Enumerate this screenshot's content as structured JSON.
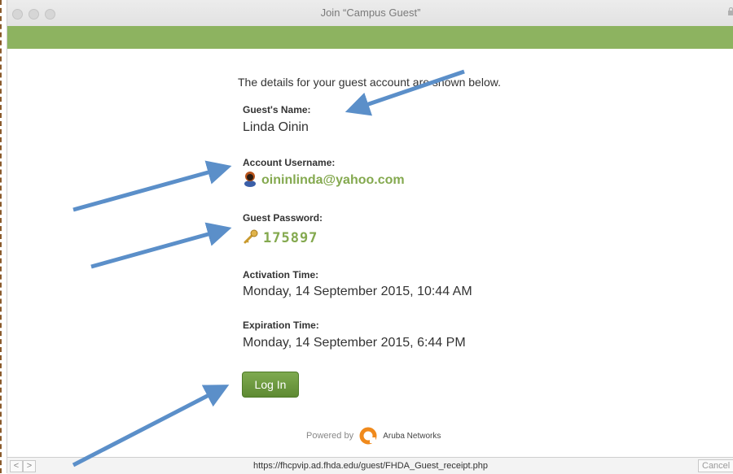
{
  "window": {
    "title": "Join “Campus Guest”"
  },
  "receipt": {
    "intro": "The details for your guest account are shown below.",
    "guest_name_label": "Guest's Name:",
    "guest_name": "Linda Oinin",
    "username_label": "Account Username:",
    "username": "oininlinda@yahoo.com",
    "password_label": "Guest Password:",
    "password": "175897",
    "activation_label": "Activation Time:",
    "activation_time": "Monday, 14 September 2015, 10:44 AM",
    "expiration_label": "Expiration Time:",
    "expiration_time": "Monday, 14 September 2015, 6:44 PM",
    "login_label": "Log In"
  },
  "footer": {
    "powered_by": "Powered by",
    "brand": "Aruba Networks"
  },
  "statusbar": {
    "url": "https://fhcpvip.ad.fhda.edu/guest/FHDA_Guest_receipt.php",
    "cancel_label": "Cancel",
    "back_glyph": "<",
    "forward_glyph": ">"
  },
  "colors": {
    "accent_green": "#8db360",
    "value_green": "#84a94f",
    "button_green": "#6a9a3e",
    "arrow_blue": "#5b8fc9"
  },
  "icons": [
    "user-avatar-icon",
    "key-icon",
    "aruba-logo-icon",
    "lock-icon"
  ]
}
